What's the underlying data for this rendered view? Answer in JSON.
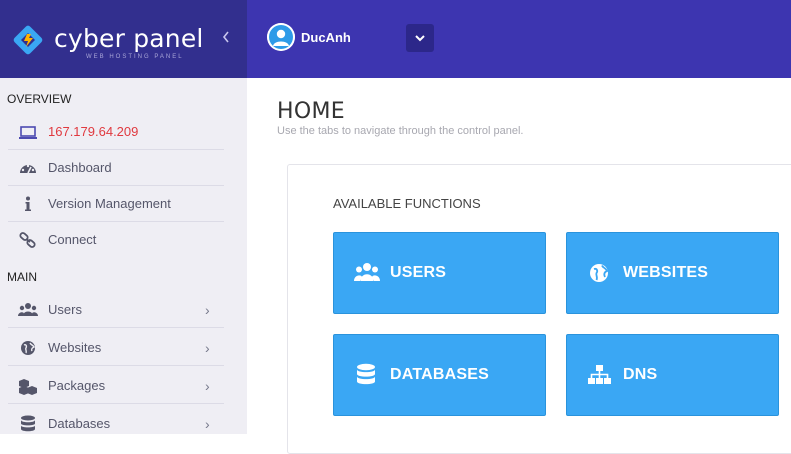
{
  "brand": {
    "name": "cyber panel",
    "subtitle": "WEB HOSTING PANEL",
    "collapse_icon": "chevron-left-icon"
  },
  "user": {
    "name": "DucAnh",
    "dropdown_icon": "chevron-down-icon"
  },
  "sidebar": {
    "sections": [
      {
        "title": "OVERVIEW",
        "items": [
          {
            "label": "167.179.64.209",
            "icon": "laptop-icon",
            "active": true
          },
          {
            "label": "Dashboard",
            "icon": "dashboard-icon"
          },
          {
            "label": "Version Management",
            "icon": "info-icon"
          },
          {
            "label": "Connect",
            "icon": "link-icon"
          }
        ]
      },
      {
        "title": "MAIN",
        "items": [
          {
            "label": "Users",
            "icon": "users-icon",
            "chevron": "›"
          },
          {
            "label": "Websites",
            "icon": "globe-icon",
            "chevron": "›"
          },
          {
            "label": "Packages",
            "icon": "cubes-icon",
            "chevron": "›"
          },
          {
            "label": "Databases",
            "icon": "database-icon",
            "chevron": "›"
          }
        ]
      }
    ]
  },
  "main": {
    "title": "HOME",
    "subtitle": "Use the tabs to navigate through the control panel.",
    "functions_heading": "AVAILABLE FUNCTIONS",
    "functions": [
      {
        "label": "USERS",
        "icon": "users-icon"
      },
      {
        "label": "WEBSITES",
        "icon": "globe-icon"
      },
      {
        "label": "DATABASES",
        "icon": "database-icon"
      },
      {
        "label": "DNS",
        "icon": "sitemap-icon"
      }
    ]
  },
  "colors": {
    "brand_bg": "#322f8e",
    "topbar_bg": "#3d35b0",
    "sidebar_bg": "#efeef4",
    "tile_bg": "#3aa7f4",
    "active_text": "#e0393f"
  }
}
